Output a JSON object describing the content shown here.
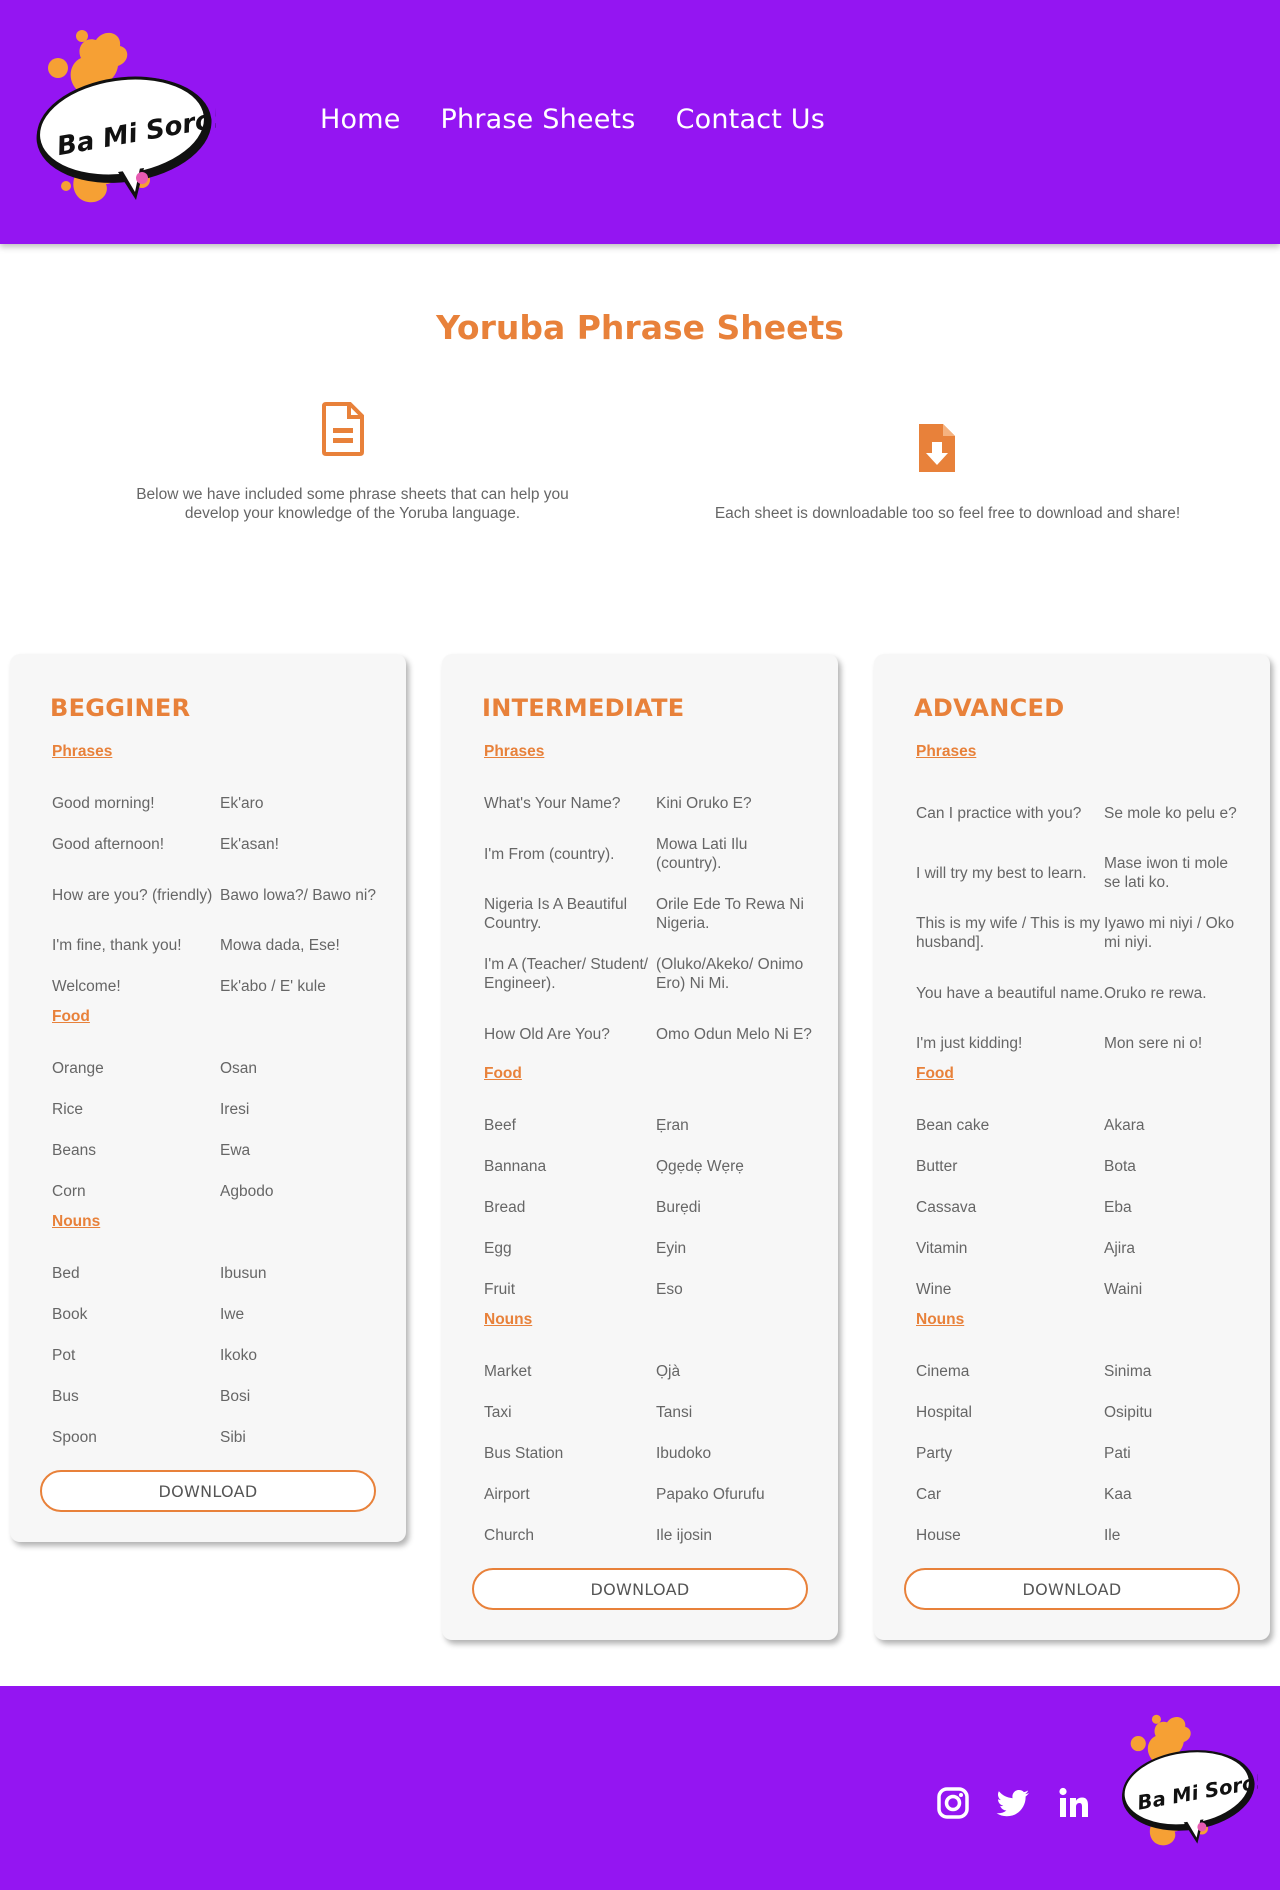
{
  "brand": {
    "logo_text": "Ba Mi Soro!",
    "primary_color": "#9415f2",
    "accent_color": "#e8813a"
  },
  "nav": {
    "items": [
      {
        "label": "Home"
      },
      {
        "label": "Phrase Sheets"
      },
      {
        "label": "Contact Us"
      }
    ]
  },
  "main": {
    "title": "Yoruba Phrase Sheets",
    "intro_left_icon": "document-icon",
    "intro_left": "Below we have included some phrase sheets that can help you develop your knowledge of the Yoruba language.",
    "intro_right_icon": "file-download-icon",
    "intro_right": "Each sheet is downloadable too so feel free to download and share!"
  },
  "cards": [
    {
      "title": "BEGGINER",
      "download_label": "DOWNLOAD",
      "sections": [
        {
          "title": "Phrases",
          "rows": [
            {
              "en": "Good morning!",
              "yo": "Ek'aro"
            },
            {
              "en": "Good afternoon!",
              "yo": "Ek'asan!"
            },
            {
              "en": "How are you? (friendly)",
              "yo": "Bawo lowa?/ Bawo ni?"
            },
            {
              "en": "I'm fine, thank you!",
              "yo": "Mowa dada, Ese!"
            },
            {
              "en": "Welcome!",
              "yo": "Ek'abo / E' kule"
            }
          ]
        },
        {
          "title": "Food",
          "rows": [
            {
              "en": "Orange",
              "yo": "Osan"
            },
            {
              "en": "Rice",
              "yo": "Iresi"
            },
            {
              "en": "Beans",
              "yo": "Ewa"
            },
            {
              "en": "Corn",
              "yo": "Agbodo"
            }
          ]
        },
        {
          "title": "Nouns",
          "rows": [
            {
              "en": "Bed",
              "yo": "Ibusun"
            },
            {
              "en": "Book",
              "yo": "Iwe"
            },
            {
              "en": "Pot",
              "yo": "Ikoko"
            },
            {
              "en": "Bus",
              "yo": "Bosi"
            },
            {
              "en": "Spoon",
              "yo": "Sibi"
            }
          ]
        }
      ]
    },
    {
      "title": "INTERMEDIATE",
      "download_label": "DOWNLOAD",
      "sections": [
        {
          "title": "Phrases",
          "rows": [
            {
              "en": "What's Your Name?",
              "yo": "Kini Oruko E?"
            },
            {
              "en": "I'm From (country).",
              "yo": "Mowa Lati Ilu (country)."
            },
            {
              "en": "Nigeria Is A Beautiful Country.",
              "yo": "Orile Ede To Rewa Ni Nigeria."
            },
            {
              "en": "I'm A (Teacher/ Student/ Engineer).",
              "yo": "(Oluko/Akeko/ Onimo Ero) Ni Mi."
            },
            {
              "en": "How Old Are You?",
              "yo": "Omo Odun Melo Ni E?"
            }
          ]
        },
        {
          "title": "Food",
          "rows": [
            {
              "en": "Beef",
              "yo": "Ẹran"
            },
            {
              "en": "Bannana",
              "yo": "Ọgẹdẹ Wẹrẹ"
            },
            {
              "en": "Bread",
              "yo": "Burẹdi"
            },
            {
              "en": "Egg",
              "yo": "Eyin"
            },
            {
              "en": "Fruit",
              "yo": "Eso"
            }
          ]
        },
        {
          "title": "Nouns",
          "rows": [
            {
              "en": "Market",
              "yo": "Ọjà"
            },
            {
              "en": "Taxi",
              "yo": "Tansi"
            },
            {
              "en": "Bus Station",
              "yo": "Ibudoko"
            },
            {
              "en": "Airport",
              "yo": "Papako Ofurufu"
            },
            {
              "en": "Church",
              "yo": "Ile ijosin"
            }
          ]
        }
      ]
    },
    {
      "title": "ADVANCED",
      "download_label": "DOWNLOAD",
      "sections": [
        {
          "title": "Phrases",
          "rows": [
            {
              "en": "Can I practice with you?",
              "yo": "Se mole ko pelu e?"
            },
            {
              "en": "I will try my best to learn.",
              "yo": "Mase iwon ti mole se lati ko."
            },
            {
              "en": "This is my wife / This is my husband].",
              "yo": "Iyawo mi niyi / Oko mi niyi."
            },
            {
              "en": "You have a beautiful name.",
              "yo": "Oruko re rewa."
            },
            {
              "en": "I'm just kidding!",
              "yo": "Mon sere ni o!"
            }
          ]
        },
        {
          "title": "Food",
          "rows": [
            {
              "en": "Bean cake",
              "yo": "Akara"
            },
            {
              "en": "Butter",
              "yo": "Bota"
            },
            {
              "en": "Cassava",
              "yo": "Eba"
            },
            {
              "en": "Vitamin",
              "yo": "Ajira"
            },
            {
              "en": "Wine",
              "yo": "Waini"
            }
          ]
        },
        {
          "title": "Nouns",
          "rows": [
            {
              "en": "Cinema",
              "yo": "Sinima"
            },
            {
              "en": "Hospital",
              "yo": "Osipitu"
            },
            {
              "en": "Party",
              "yo": "Pati"
            },
            {
              "en": "Car",
              "yo": "Kaa"
            },
            {
              "en": "House",
              "yo": "Ile"
            }
          ]
        }
      ]
    }
  ],
  "footer": {
    "social": [
      {
        "icon": "instagram-icon"
      },
      {
        "icon": "twitter-icon"
      },
      {
        "icon": "linkedin-icon"
      }
    ]
  }
}
